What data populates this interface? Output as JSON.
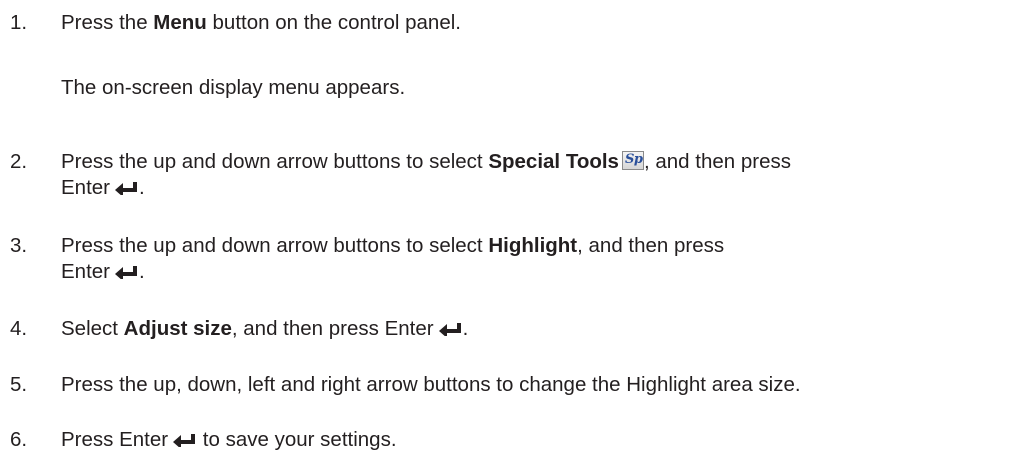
{
  "steps": [
    {
      "number": "1.",
      "before": "Press the ",
      "bold": "Menu",
      "after": " button on the control panel.",
      "result": "The on-screen display menu appears."
    },
    {
      "number": "2.",
      "before": "Press the up and down arrow buttons to select ",
      "bold": "Special Tools",
      "icon_text": "Sp",
      "after": ", and then press",
      "line2_before": "Enter",
      "line2_after": "."
    },
    {
      "number": "3.",
      "before": "Press the up and down arrow buttons to select ",
      "bold": "Highlight",
      "after": ", and then press",
      "line2_before": "Enter",
      "line2_after": "."
    },
    {
      "number": "4.",
      "before": "Select ",
      "bold": "Adjust size",
      "after": ", and then press Enter",
      "end": "."
    },
    {
      "number": "5.",
      "text": "Press the up, down, left and right arrow buttons to change the Highlight area size."
    },
    {
      "number": "6.",
      "before": "Press Enter",
      "after": " to save your settings."
    }
  ],
  "icons": {
    "special_tools": "special-tools-sp-icon",
    "enter": "enter-arrow-icon"
  },
  "colors": {
    "text": "#231f20",
    "icon_text": "#2a4f9a"
  }
}
